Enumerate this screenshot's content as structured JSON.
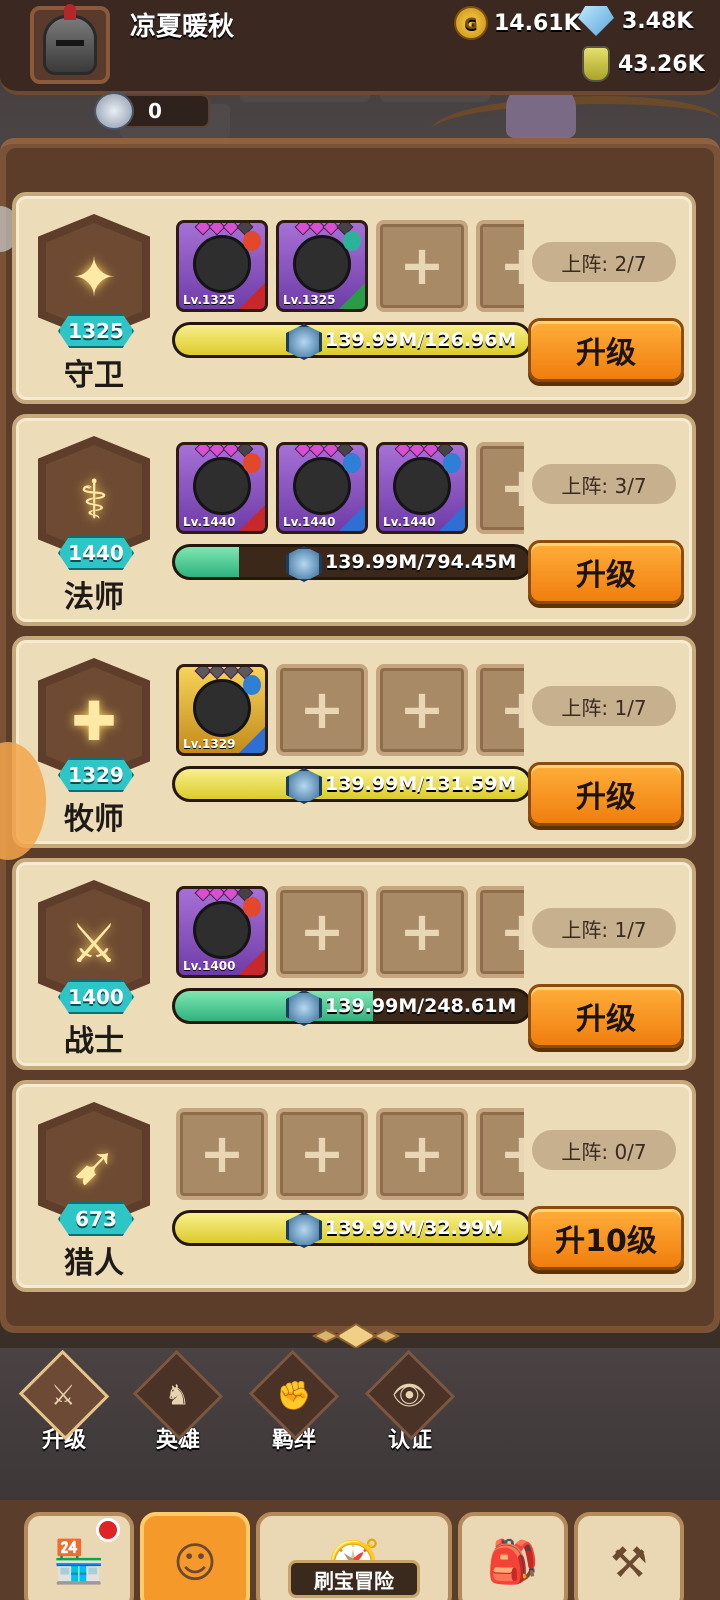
{
  "header": {
    "player_name": "凉夏暖秋",
    "gold": "14.61K",
    "diamonds": "3.48K",
    "potions": "43.26K",
    "silver": "0"
  },
  "classes": [
    {
      "key": "guard",
      "name": "守卫",
      "level": "1325",
      "glyph": "✦",
      "deploy": "上阵: 2/7",
      "progress_text": "139.99M/126.96M",
      "progress_fill": 1.0,
      "fill_color": "yellow",
      "button": "升级",
      "heroes": [
        {
          "lv": "Lv.1325",
          "frame": "purple",
          "stars": 3,
          "elem": "#e4482a",
          "corner": "#c8282a"
        },
        {
          "lv": "Lv.1325",
          "frame": "purple",
          "stars": 3,
          "elem": "#2bb39a",
          "corner": "#2a9c48"
        }
      ]
    },
    {
      "key": "mage",
      "name": "法师",
      "level": "1440",
      "glyph": "⚕",
      "deploy": "上阵: 3/7",
      "progress_text": "139.99M/794.45M",
      "progress_fill": 0.18,
      "fill_color": "green",
      "button": "升级",
      "heroes": [
        {
          "lv": "Lv.1440",
          "frame": "purple",
          "stars": 3,
          "elem": "#e4482a",
          "corner": "#c8282a"
        },
        {
          "lv": "Lv.1440",
          "frame": "purple",
          "stars": 3,
          "elem": "#2e7fd6",
          "corner": "#2e6fd6"
        },
        {
          "lv": "Lv.1440",
          "frame": "purple",
          "stars": 3,
          "elem": "#2e7fd6",
          "corner": "#2e6fd6"
        }
      ]
    },
    {
      "key": "priest",
      "name": "牧师",
      "level": "1329",
      "glyph": "✚",
      "deploy": "上阵: 1/7",
      "progress_text": "139.99M/131.59M",
      "progress_fill": 1.0,
      "fill_color": "yellow",
      "button": "升级",
      "heroes": [
        {
          "lv": "Lv.1329",
          "frame": "gold",
          "stars": 4,
          "elem": "#2e7fd6",
          "corner": "#2e6fd6"
        }
      ]
    },
    {
      "key": "warrior",
      "name": "战士",
      "level": "1400",
      "glyph": "⚔",
      "deploy": "上阵: 1/7",
      "progress_text": "139.99M/248.61M",
      "progress_fill": 0.56,
      "fill_color": "green",
      "button": "升级",
      "heroes": [
        {
          "lv": "Lv.1400",
          "frame": "purple",
          "stars": 3,
          "elem": "#e4482a",
          "corner": "#c8282a"
        }
      ]
    },
    {
      "key": "hunter",
      "name": "猎人",
      "level": "673",
      "glyph": "➹",
      "deploy": "上阵: 0/7",
      "progress_text": "139.99M/32.99M",
      "progress_fill": 1.0,
      "fill_color": "yellow",
      "button": "升10级",
      "heroes": []
    }
  ],
  "tabs": [
    {
      "label": "升级",
      "icon": "sword-icon",
      "active": true
    },
    {
      "label": "英雄",
      "icon": "hero-icon",
      "active": false
    },
    {
      "label": "羁绊",
      "icon": "fist-icon",
      "active": false
    },
    {
      "label": "认证",
      "icon": "eye-icon",
      "active": false
    }
  ],
  "nav": {
    "adventure_label": "刷宝冒险"
  }
}
